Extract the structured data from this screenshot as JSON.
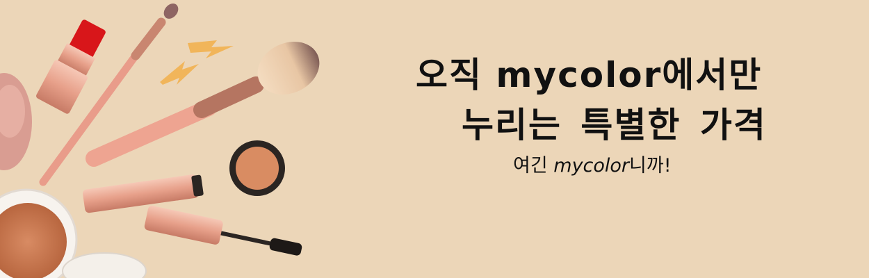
{
  "banner": {
    "headline_line1_prefix": "오직 ",
    "headline_brand": "mycolor",
    "headline_line1_suffix": "에서만",
    "headline_line2": "누리는 특별한 가격",
    "tagline_prefix": "여긴 ",
    "tagline_brand": "mycolor",
    "tagline_suffix": "니까!"
  },
  "colors": {
    "background": "#ecd6b8",
    "text": "#111111",
    "rose_gold": "#e9a994",
    "lipstick_red": "#d8161a"
  },
  "icons": [
    "lipstick-icon",
    "brush-icon",
    "lightning-icon",
    "mascara-icon",
    "compact-icon",
    "sponge-icon"
  ]
}
